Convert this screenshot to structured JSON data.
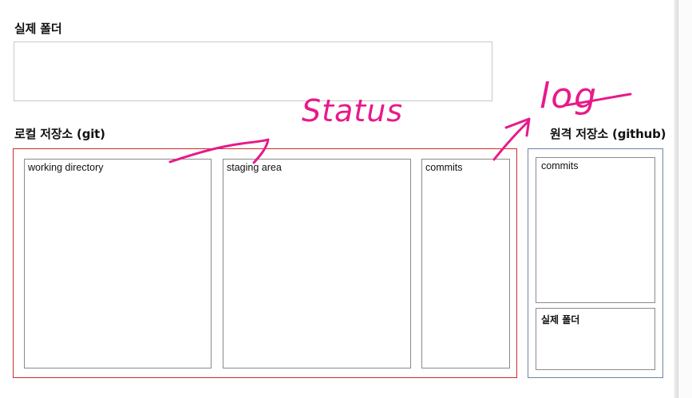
{
  "headings": {
    "real_folder": "실제 폴더",
    "local_repo": "로컬 저장소 (git)",
    "remote_repo": "원격 저장소 (github)"
  },
  "local": {
    "working_directory": "working directory",
    "staging_area": "staging area",
    "commits": "commits"
  },
  "remote": {
    "commits": "commits",
    "real_folder": "실제 폴더"
  },
  "annotations": {
    "status": "Status",
    "log": "log"
  },
  "colors": {
    "local_border": "#cc2b2b",
    "remote_border": "#6c84a6",
    "ink": "#e8198b"
  }
}
